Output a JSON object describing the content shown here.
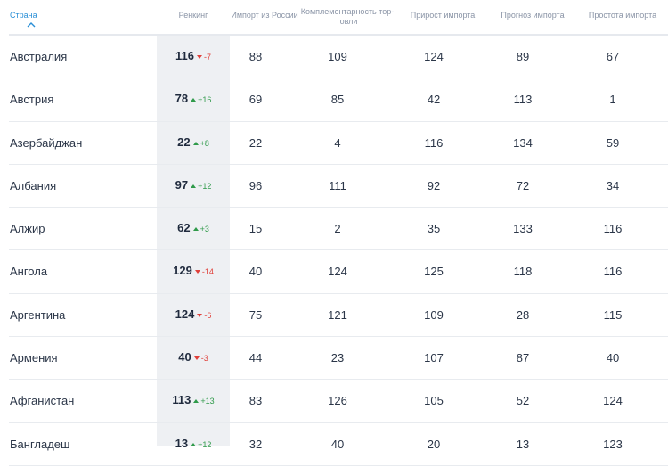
{
  "header": {
    "country": "Страна",
    "ranking": "Ренкинг",
    "import_from_russia": "Импорт из России",
    "complementarity_line1": "Комплементарность тор-",
    "complementarity_line2": "говли",
    "import_growth": "Прирост импорта",
    "import_forecast": "Прогноз импорта",
    "import_ease": "Простота импорта"
  },
  "rows": [
    {
      "country": "Австралия",
      "rank": "116",
      "delta": "-7",
      "dir": "down",
      "imp": "88",
      "comp": "109",
      "growth": "124",
      "forecast": "89",
      "ease": "67"
    },
    {
      "country": "Австрия",
      "rank": "78",
      "delta": "+16",
      "dir": "up",
      "imp": "69",
      "comp": "85",
      "growth": "42",
      "forecast": "113",
      "ease": "1"
    },
    {
      "country": "Азербайджан",
      "rank": "22",
      "delta": "+8",
      "dir": "up",
      "imp": "22",
      "comp": "4",
      "growth": "116",
      "forecast": "134",
      "ease": "59"
    },
    {
      "country": "Албания",
      "rank": "97",
      "delta": "+12",
      "dir": "up",
      "imp": "96",
      "comp": "111",
      "growth": "92",
      "forecast": "72",
      "ease": "34"
    },
    {
      "country": "Алжир",
      "rank": "62",
      "delta": "+3",
      "dir": "up",
      "imp": "15",
      "comp": "2",
      "growth": "35",
      "forecast": "133",
      "ease": "116"
    },
    {
      "country": "Ангола",
      "rank": "129",
      "delta": "-14",
      "dir": "down",
      "imp": "40",
      "comp": "124",
      "growth": "125",
      "forecast": "118",
      "ease": "116"
    },
    {
      "country": "Аргентина",
      "rank": "124",
      "delta": "-6",
      "dir": "down",
      "imp": "75",
      "comp": "121",
      "growth": "109",
      "forecast": "28",
      "ease": "115"
    },
    {
      "country": "Армения",
      "rank": "40",
      "delta": "-3",
      "dir": "down",
      "imp": "44",
      "comp": "23",
      "growth": "107",
      "forecast": "87",
      "ease": "40"
    },
    {
      "country": "Афганистан",
      "rank": "113",
      "delta": "+13",
      "dir": "up",
      "imp": "83",
      "comp": "126",
      "growth": "105",
      "forecast": "52",
      "ease": "124"
    },
    {
      "country": "Бангладеш",
      "rank": "13",
      "delta": "+12",
      "dir": "up",
      "imp": "32",
      "comp": "40",
      "growth": "20",
      "forecast": "13",
      "ease": "123"
    }
  ]
}
